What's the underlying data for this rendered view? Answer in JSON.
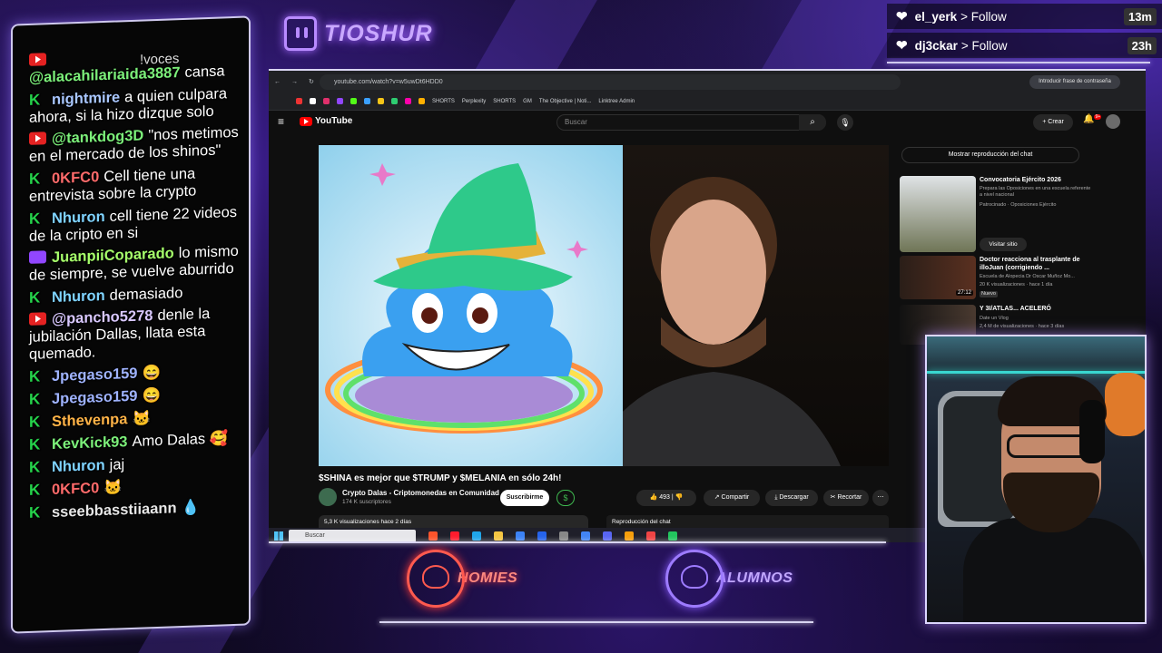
{
  "overlay": {
    "streamer_name": "TIOSHUR",
    "follows": [
      {
        "user": "el_yerk",
        "action": "Follow",
        "time": "13m"
      },
      {
        "user": "dj3ckar",
        "action": "Follow",
        "time": "23h"
      }
    ],
    "logos": {
      "left": "HOMIES",
      "right": "ALUMNOS"
    }
  },
  "chat": {
    "top_fragment": "!voces",
    "messages": [
      {
        "platform": "youtube",
        "user": "@alacahilariaida3887",
        "user_color": "#7cf07a",
        "text": "cansa"
      },
      {
        "platform": "kick",
        "user": "nightmire",
        "user_color": "#a9c7ff",
        "text": "a quien culpara ahora, si la hizo dizque solo"
      },
      {
        "platform": "youtube",
        "user": "@tankdog3D",
        "user_color": "#7cf07a",
        "text": "\"nos metimos en el mercado de los shinos\""
      },
      {
        "platform": "kick",
        "user": "0KFC0",
        "user_color": "#ff6b6b",
        "text": "Cell tiene una entrevista sobre la crypto"
      },
      {
        "platform": "kick",
        "user": "Nhuron",
        "user_color": "#7fd3ff",
        "text": "cell tiene 22 videos de la cripto en si"
      },
      {
        "platform": "twitch",
        "user": "JuanpiiCoparado",
        "user_color": "#a6ff6b",
        "text": "lo mismo de siempre, se vuelve aburrido"
      },
      {
        "platform": "kick",
        "user": "Nhuron",
        "user_color": "#7fd3ff",
        "text": "demasiado"
      },
      {
        "platform": "youtube",
        "user": "@pancho5278",
        "user_color": "#d9c8ff",
        "text": "denle la jubilación Dallas, llata esta quemado."
      },
      {
        "platform": "kick",
        "user": "Jpegaso159",
        "user_color": "#9fb3ff",
        "text": "😄"
      },
      {
        "platform": "kick",
        "user": "Jpegaso159",
        "user_color": "#9fb3ff",
        "text": "😄"
      },
      {
        "platform": "kick",
        "user": "Sthevenpa",
        "user_color": "#ffb347",
        "text": "🐱"
      },
      {
        "platform": "kick",
        "user": "KevKick93",
        "user_color": "#7cf07a",
        "text": "Amo Dalas 🥰"
      },
      {
        "platform": "kick",
        "user": "Nhuron",
        "user_color": "#7fd3ff",
        "text": "jaj"
      },
      {
        "platform": "kick",
        "user": "0KFC0",
        "user_color": "#ff6b6b",
        "text": "🐱"
      },
      {
        "platform": "kick",
        "user": "sseebbasstiiaann",
        "user_color": "#e6e6e6",
        "text": "💧"
      }
    ]
  },
  "browser": {
    "url": "youtube.com/watch?v=w5uwDt6HDD0",
    "password_prompt": "Introducir frase de contraseña",
    "bookmarks": [
      "SHORTS",
      "Perplexity",
      "SHORTS",
      "GM",
      "The Objective | Noti...",
      "Linktree Admin"
    ],
    "youtube": {
      "logo": "YouTube",
      "search_placeholder": "Buscar",
      "create_label": "Crear",
      "notif_count": "9+",
      "video_title": "$SHINA es mejor que $TRUMP y $MELANIA en sólo 24h!",
      "channel_name": "Crypto Dalas - Criptomonedas en Comunidad",
      "channel_subs": "174 K suscriptores",
      "subscribe_label": "Suscribirme",
      "likes": "493",
      "share_label": "Compartir",
      "download_label": "Descargar",
      "clip_label": "Recortar",
      "views": "5,3 K visualizaciones  hace 2 días",
      "chat_replay_bottom": "Reproducción del chat",
      "show_chat": "Mostrar reproducción del chat",
      "recs": [
        {
          "title": "Convocatoria Ejército 2026",
          "sub": "Prepara las Oposiciones en una escuela referente a nivel nacional",
          "meta": "Patrocinado · Oposiciones Ejército",
          "button": "Visitar sitio"
        },
        {
          "title": "Doctor reacciona al trasplante de illoJuan (corrigiendo ...",
          "sub": "Escuela de Alopecia Dr Oscar Muñoz Mo...",
          "meta": "20 K visualizaciones · hace 1 día",
          "badge": "Nuevo",
          "duration": "27:12"
        },
        {
          "title": "Y 3I/ATLAS... ACELERÓ",
          "sub": "Date un Vlog",
          "meta": "2,4 M de visualizaciones · hace 3 días"
        }
      ]
    },
    "taskbar_search": "Buscar"
  }
}
